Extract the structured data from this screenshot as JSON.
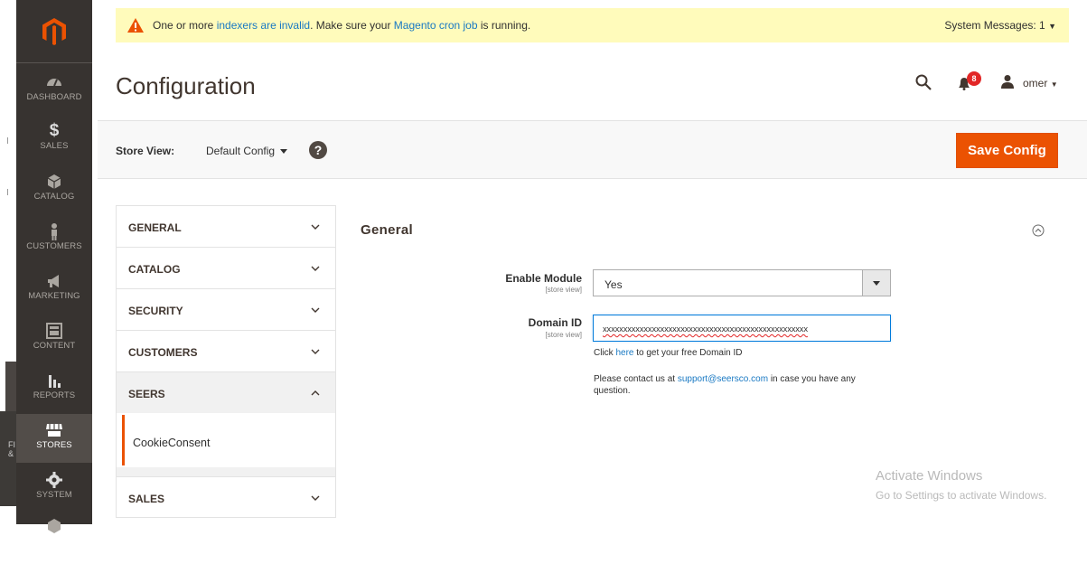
{
  "nav": {
    "items": [
      {
        "label": "DASHBOARD",
        "icon": "gauge-icon"
      },
      {
        "label": "SALES",
        "icon": "dollar-icon"
      },
      {
        "label": "CATALOG",
        "icon": "box-icon"
      },
      {
        "label": "CUSTOMERS",
        "icon": "person-icon"
      },
      {
        "label": "MARKETING",
        "icon": "megaphone-icon"
      },
      {
        "label": "CONTENT",
        "icon": "layout-icon"
      },
      {
        "label": "REPORTS",
        "icon": "bar-chart-icon"
      },
      {
        "label": "STORES",
        "icon": "storefront-icon"
      },
      {
        "label": "SYSTEM",
        "icon": "gear-icon"
      }
    ],
    "active": "STORES",
    "left_strip_text": "FI\n&"
  },
  "system_message": {
    "prefix": "One or more ",
    "link1": "indexers are invalid",
    "middle": ". Make sure your ",
    "link2": "Magento cron job",
    "suffix": " is running.",
    "counter": "System Messages: 1"
  },
  "header": {
    "title": "Configuration",
    "notifications_count": "8",
    "username": "omer"
  },
  "store_view": {
    "label": "Store View:",
    "value": "Default Config",
    "help": "?",
    "save_label": "Save Config"
  },
  "tabs": {
    "general": "GENERAL",
    "catalog": "CATALOG",
    "security": "SECURITY",
    "customers": "CUSTOMERS",
    "seers": "SEERS",
    "seers_sub": "CookieConsent",
    "sales": "SALES"
  },
  "section": {
    "title": "General",
    "enable_label": "Enable Module",
    "enable_scope": "[store view]",
    "enable_value": "Yes",
    "domain_label": "Domain ID",
    "domain_scope": "[store view]",
    "domain_value": "xxxxxxxxxxxxxxxxxxxxxxxxxxxxxxxxxxxxxxxxxxxxxxxxxx",
    "note1_prefix": "Click ",
    "note1_link": "here",
    "note1_suffix": " to get your free Domain ID",
    "note2_prefix": "Please contact us at ",
    "note2_link": "support@seersco.com",
    "note2_suffix": " in case you have any question."
  },
  "watermark": {
    "line1": "Activate Windows",
    "line2": "Go to Settings to activate Windows."
  },
  "colors": {
    "sidebar": "#373330",
    "accent": "#eb5202",
    "link": "#1979c3",
    "message_bg": "#fffbbb",
    "badge": "#e22626"
  }
}
